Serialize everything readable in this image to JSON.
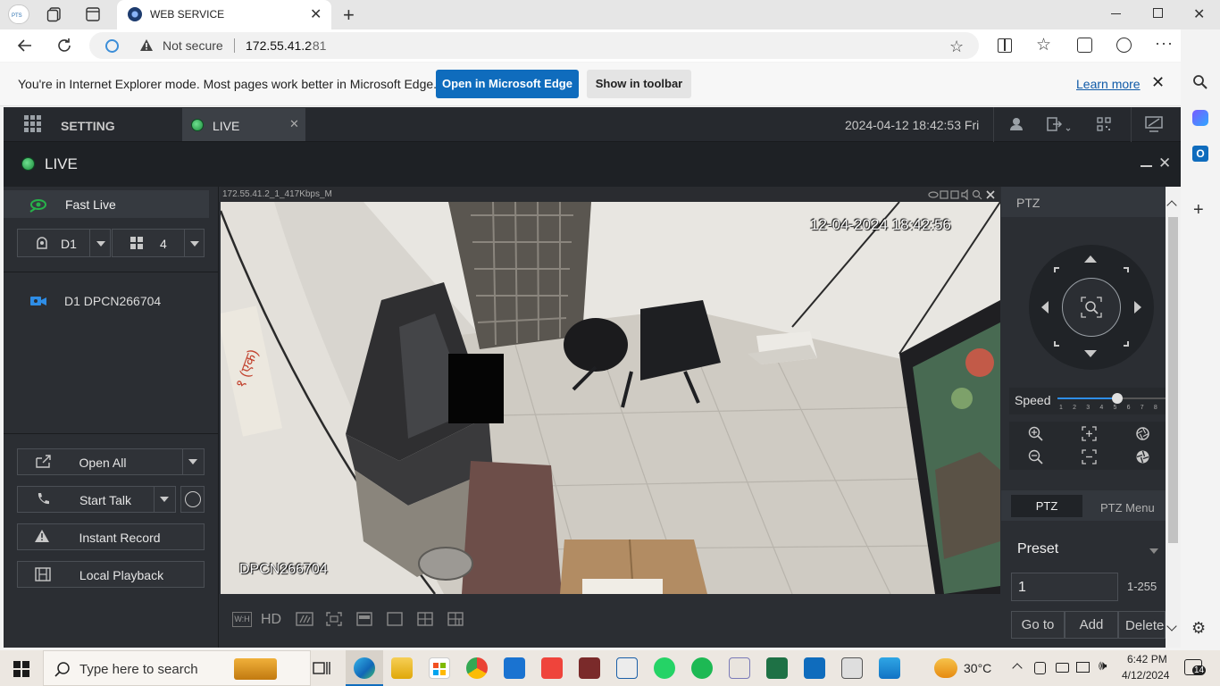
{
  "browser": {
    "tab_title": "WEB SERVICE",
    "url_host": "172.55.41.2",
    "url_port": ":81",
    "not_secure": "Not secure"
  },
  "ie_bar": {
    "message": "You're in Internet Explorer mode. Most pages work better in Microsoft Edge.",
    "open_edge": "Open in Microsoft Edge",
    "show_toolbar": "Show in toolbar",
    "learn_more": "Learn more"
  },
  "app": {
    "setting_label": "SETTING",
    "live_tab": "LIVE",
    "datetime": "2024-04-12 18:42:53 Fri",
    "live_title": "LIVE"
  },
  "left": {
    "fast_live": "Fast Live",
    "device_select": "D1",
    "split_select": "4",
    "device_entry": "D1 DPCN266704",
    "open_all": "Open All",
    "start_talk": "Start Talk",
    "instant_record": "Instant Record",
    "local_playback": "Local Playback"
  },
  "video": {
    "stream_info": "172.55.41.2_1_417Kbps_M",
    "timestamp_overlay": "12-04-2024 18:42:56",
    "camera_name": "DPCN266704",
    "toolbar": {
      "wh": "W:H",
      "hd": "HD"
    }
  },
  "ptz": {
    "title": "PTZ",
    "speed_label": "Speed",
    "speed_ticks": [
      "1",
      "2",
      "3",
      "4",
      "5",
      "6",
      "7",
      "8"
    ],
    "speed_value": 5,
    "tab_ptz": "PTZ",
    "tab_menu": "PTZ Menu",
    "preset_label": "Preset",
    "preset_value": "1",
    "preset_range": "1-255",
    "goto": "Go to",
    "add": "Add",
    "delete": "Delete"
  },
  "taskbar": {
    "search_placeholder": "Type here to search",
    "weather": "30°C",
    "time": "6:42 PM",
    "date": "4/12/2024",
    "notifications": "14"
  },
  "colors": {
    "accent_blue": "#0f6cbd",
    "app_dark": "#2b2e33",
    "live_green": "#27b24a",
    "camera_icon_blue": "#2e8de6"
  }
}
